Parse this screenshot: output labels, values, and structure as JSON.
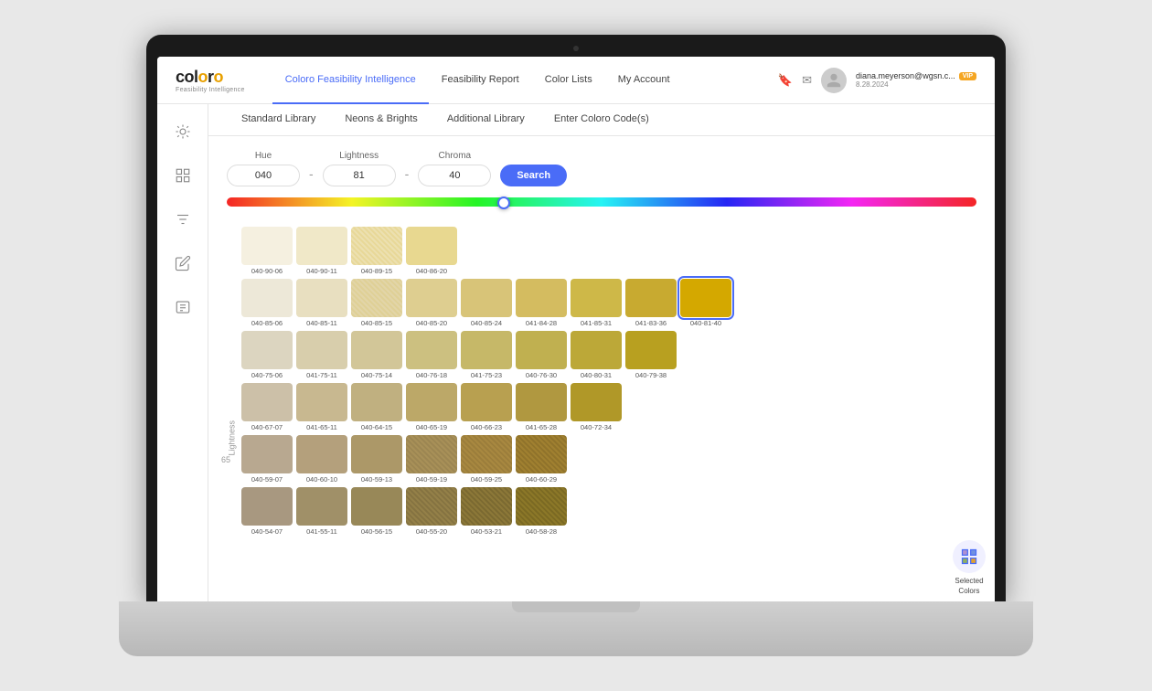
{
  "app": {
    "title": "Coloro",
    "subtitle": "Feasibility Intelligence"
  },
  "nav": {
    "links": [
      {
        "label": "Coloro Feasibility Intelligence",
        "active": true
      },
      {
        "label": "Feasibility Report",
        "active": false
      },
      {
        "label": "Color Lists",
        "active": false
      },
      {
        "label": "My Account",
        "active": false
      }
    ],
    "user": {
      "email": "diana.meyerson@wgsn.c...",
      "date": "8.28.2024",
      "vip": "VIP"
    }
  },
  "sidebar": {
    "icons": [
      "☀",
      "⊞",
      "⇌",
      "✏",
      "☰"
    ]
  },
  "sub_tabs": [
    {
      "label": "Standard Library",
      "active": false
    },
    {
      "label": "Neons & Brights",
      "active": false
    },
    {
      "label": "Additional Library",
      "active": false
    },
    {
      "label": "Enter Coloro Code(s)",
      "active": false
    }
  ],
  "search": {
    "hue_label": "Hue",
    "hue_value": "040",
    "lightness_label": "Lightness",
    "lightness_value": "81",
    "chroma_label": "Chroma",
    "chroma_value": "40",
    "button_label": "Search"
  },
  "axis_label": "Lightness",
  "row_label_65": "65",
  "color_rows": [
    {
      "label": "",
      "colors": [
        {
          "code": "040-90-06",
          "bg": "#f5f0e0"
        },
        {
          "code": "040-90-11",
          "bg": "#f0e8c8"
        },
        {
          "code": "040-89-15",
          "bg": "#ece0b0",
          "pattern": true
        },
        {
          "code": "040-86-20",
          "bg": "#e8d890"
        }
      ]
    },
    {
      "label": "",
      "colors": [
        {
          "code": "040-85-06",
          "bg": "#ede8d8"
        },
        {
          "code": "040-85-11",
          "bg": "#e8dfc0"
        },
        {
          "code": "040-85-15",
          "bg": "#e2d5a8",
          "pattern": true
        },
        {
          "code": "040-85-20",
          "bg": "#dece90"
        },
        {
          "code": "040-85-24",
          "bg": "#d8c478"
        },
        {
          "code": "041-84-28",
          "bg": "#d4bc60"
        },
        {
          "code": "041-85-31",
          "bg": "#ceb848"
        },
        {
          "code": "041-83-36",
          "bg": "#c8aa30"
        },
        {
          "code": "040-81-40",
          "bg": "#d4a800",
          "selected": true
        }
      ]
    },
    {
      "label": "",
      "colors": [
        {
          "code": "040-75-06",
          "bg": "#dcd5c0"
        },
        {
          "code": "041-75-11",
          "bg": "#d8ceac"
        },
        {
          "code": "040-75-14",
          "bg": "#d2c698"
        },
        {
          "code": "040-76-18",
          "bg": "#ccc080"
        },
        {
          "code": "041-75-23",
          "bg": "#c6b868"
        },
        {
          "code": "040-76-30",
          "bg": "#c0b050"
        },
        {
          "code": "040-80-31",
          "bg": "#bca838"
        },
        {
          "code": "040-79-38",
          "bg": "#b8a020"
        }
      ]
    },
    {
      "label": "",
      "colors": [
        {
          "code": "040-67-07",
          "bg": "#ccc0a8"
        },
        {
          "code": "041-65-11",
          "bg": "#c8b890"
        },
        {
          "code": "040-64-15",
          "bg": "#c0b080"
        },
        {
          "code": "040-65-19",
          "bg": "#bca868"
        },
        {
          "code": "040-66-23",
          "bg": "#b8a050"
        },
        {
          "code": "041-65-28",
          "bg": "#b09840"
        },
        {
          "code": "040-72-34",
          "bg": "#b09828"
        }
      ]
    },
    {
      "label": "65",
      "colors": [
        {
          "code": "040-59-07",
          "bg": "#b8a890"
        },
        {
          "code": "040-60-10",
          "bg": "#b4a07c"
        },
        {
          "code": "040-59-13",
          "bg": "#ac9868"
        },
        {
          "code": "040-59-19",
          "bg": "#a89058"
        },
        {
          "code": "040-59-25",
          "bg": "#a88840"
        },
        {
          "code": "040-60-29",
          "bg": "#a08030"
        }
      ]
    },
    {
      "label": "",
      "colors": [
        {
          "code": "040-54-07",
          "bg": "#a89880"
        },
        {
          "code": "041-55-11",
          "bg": "#a09068"
        },
        {
          "code": "040-56-15",
          "bg": "#988858"
        },
        {
          "code": "040-55-20",
          "bg": "#948048"
        },
        {
          "code": "040-53-21",
          "bg": "#8c7838"
        },
        {
          "code": "040-58-28",
          "bg": "#8c7828"
        }
      ]
    }
  ],
  "selected_colors": {
    "label": "Selected\nColors"
  }
}
